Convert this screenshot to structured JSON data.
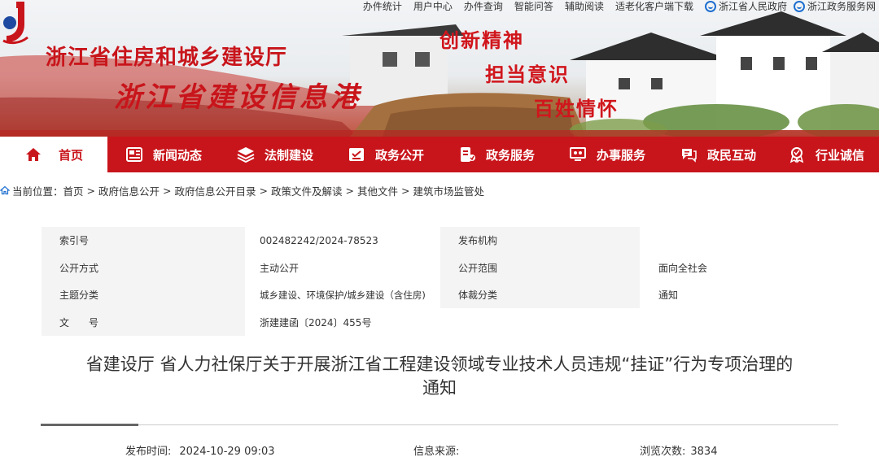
{
  "top_links": [
    "办件统计",
    "用户中心",
    "办件查询",
    "智能问答",
    "辅助阅读",
    "适老化客户端下载"
  ],
  "gov_links": [
    "浙江省人民政府",
    "浙江政务服务网"
  ],
  "banner": {
    "org_name": "浙江省住房和城乡建设厅",
    "site_name": "浙江省建设信息港",
    "slogans": [
      "创新精神",
      "担当意识",
      "百姓情怀"
    ]
  },
  "nav": [
    {
      "label": "首页",
      "icon": "home-icon"
    },
    {
      "label": "新闻动态",
      "icon": "newspaper-icon"
    },
    {
      "label": "法制建设",
      "icon": "layers-icon"
    },
    {
      "label": "政务公开",
      "icon": "document-icon"
    },
    {
      "label": "政务服务",
      "icon": "service-card-icon"
    },
    {
      "label": "办事服务",
      "icon": "monitor-icon"
    },
    {
      "label": "政民互动",
      "icon": "chat-icon"
    },
    {
      "label": "行业诚信",
      "icon": "medal-icon"
    }
  ],
  "breadcrumb": {
    "prefix": "当前位置：",
    "items": [
      "首页",
      "政府信息公开",
      "政府信息公开目录",
      "政策文件及解读",
      "其他文件",
      "建筑市场监管处"
    ],
    "separator": ">"
  },
  "info_table": {
    "rows": [
      {
        "k1": "索引号",
        "v1": "002482242/2024-78523",
        "k2": "发布机构",
        "v2": ""
      },
      {
        "k1": "公开方式",
        "v1": "主动公开",
        "k2": "公开范围",
        "v2": "面向全社会"
      },
      {
        "k1": "主题分类",
        "v1": "城乡建设、环境保护/城乡建设（含住房)",
        "k2": "体裁分类",
        "v2": "通知"
      },
      {
        "k1": "文　　号",
        "v1": "浙建建函〔2024〕455号",
        "k2": "",
        "v2": ""
      }
    ]
  },
  "article": {
    "title_line1": "省建设厅 省人力社保厅关于开展浙江省工程建设领域专业技术人员违规“挂证”行为专项治理的",
    "title_line2": "通知"
  },
  "meta": {
    "publish_label": "发布时间:",
    "publish_value": "2024-10-29 09:03",
    "source_label": "信息来源:",
    "source_value": "",
    "views_label": "浏览次数:",
    "views_value": "3834"
  },
  "colors": {
    "brand_red": "#c8151b",
    "nav_text": "#ffffff",
    "table_bg": "#f4f4f4",
    "link_blue": "#1e6fd0"
  }
}
